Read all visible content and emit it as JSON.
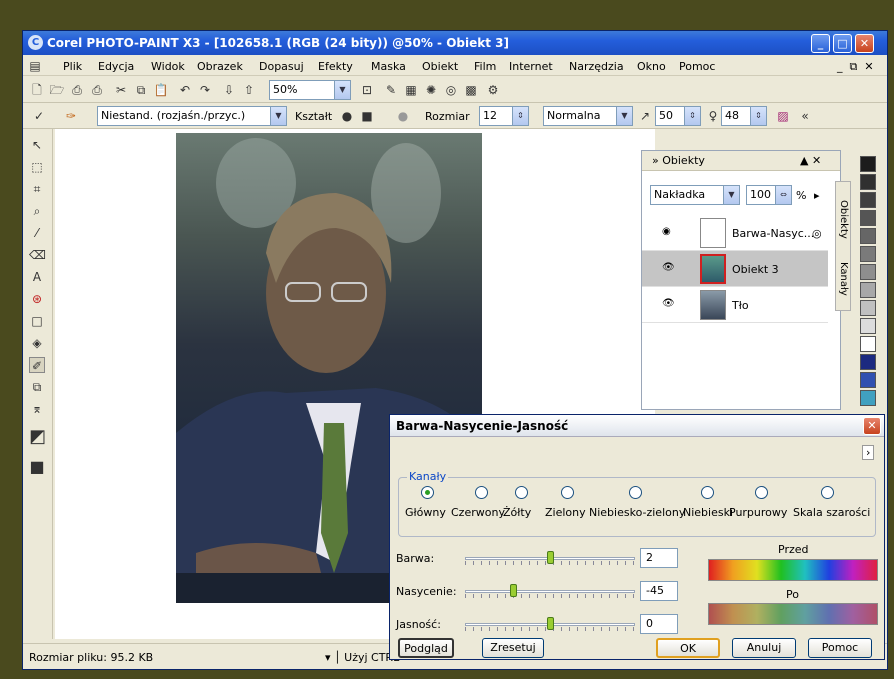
{
  "window": {
    "title": "Corel PHOTO-PAINT X3 - [102658.1 (RGB (24 bity)) @50% - Obiekt 3]"
  },
  "menu": [
    "Plik",
    "Edycja",
    "Widok",
    "Obrazek",
    "Dopasuj",
    "Efekty",
    "Maska",
    "Obiekt",
    "Film",
    "Internet",
    "Narzędzia",
    "Okno",
    "Pomoc"
  ],
  "toolbar": {
    "zoom": "50%"
  },
  "property_bar": {
    "brush_type": "Niestand. (rozjaśn./przyc.)",
    "shape_label": "Kształt",
    "size_label": "Rozmiar",
    "size_value": "12",
    "mode": "Normalna",
    "value1": "50",
    "value2": "48"
  },
  "docker": {
    "title": "Obiekty",
    "blend_mode": "Nakładka",
    "opacity": "100",
    "opacity_unit": "%",
    "side_tab_objects": "Obiekty",
    "side_tab_channels": "Kanały",
    "layers": [
      {
        "name": "Barwa-Nasyc...",
        "selected": false
      },
      {
        "name": "Obiekt 3",
        "selected": true
      },
      {
        "name": "Tło",
        "selected": false
      }
    ]
  },
  "status": {
    "file_size": "Rozmiar pliku: 95.2 KB",
    "hint": "Użyj CTRL"
  },
  "dialog": {
    "title": "Barwa-Nasycenie-Jasność",
    "group_label": "Kanały",
    "channels": [
      "Główny",
      "Czerwony",
      "Żółty",
      "Zielony",
      "Niebiesko-zielony",
      "Niebieski",
      "Purpurowy",
      "Skala szarości"
    ],
    "selected_channel": "Główny",
    "hue_label": "Barwa:",
    "hue_value": "2",
    "sat_label": "Nasycenie:",
    "sat_value": "-45",
    "light_label": "Jasność:",
    "light_value": "0",
    "before_label": "Przed",
    "after_label": "Po",
    "buttons": {
      "preview": "Podgląd",
      "reset": "Zresetuj",
      "ok": "OK",
      "cancel": "Anuluj",
      "help": "Pomoc"
    }
  },
  "colors": {
    "title_blue": "#245edb",
    "dialog_bg": "#ece9d8",
    "slider_thumb": "#9acd32"
  }
}
